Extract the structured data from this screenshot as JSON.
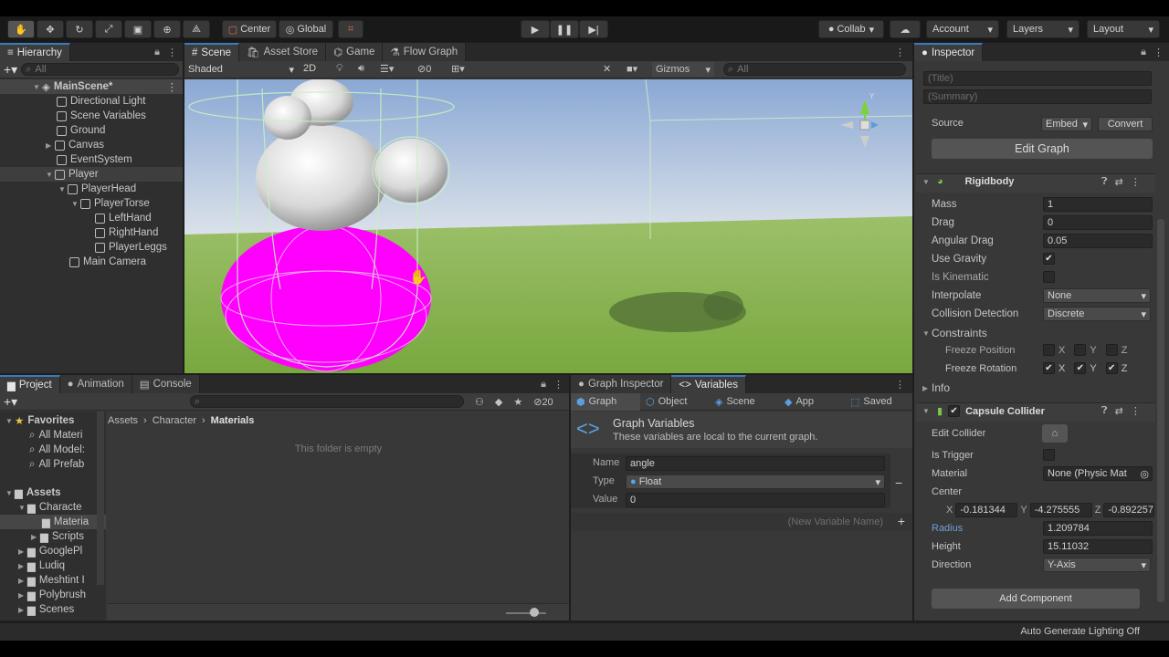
{
  "toolbar": {
    "pivot_center": "Center",
    "pivot_global": "Global",
    "collab": "Collab",
    "account": "Account",
    "layers": "Layers",
    "layout": "Layout"
  },
  "hierarchy": {
    "tab": "Hierarchy",
    "search_placeholder": "All",
    "scene": "MainScene*",
    "items": [
      {
        "label": "Directional Light"
      },
      {
        "label": "Scene Variables"
      },
      {
        "label": "Ground"
      },
      {
        "label": "Canvas"
      },
      {
        "label": "EventSystem"
      },
      {
        "label": "Player"
      },
      {
        "label": "PlayerHead"
      },
      {
        "label": "PlayerTorse"
      },
      {
        "label": "LeftHand"
      },
      {
        "label": "RightHand"
      },
      {
        "label": "PlayerLeggs"
      },
      {
        "label": "Main Camera"
      }
    ]
  },
  "scene_tabs": [
    "Scene",
    "Asset Store",
    "Game",
    "Flow Graph"
  ],
  "scene_toolbar": {
    "shading": "Shaded",
    "mode_2d": "2D",
    "gizmos": "Gizmos",
    "search_placeholder": "All",
    "fx_count": "0"
  },
  "project": {
    "tabs": [
      "Project",
      "Animation",
      "Console"
    ],
    "hidden_count": "20",
    "favorites": "Favorites",
    "fav_items": [
      "All Materi",
      "All Model:",
      "All Prefab"
    ],
    "assets": "Assets",
    "asset_items": [
      "Characte",
      "Materia",
      "Scripts",
      "GooglePl",
      "Ludiq",
      "Meshtint I",
      "Polybrush",
      "Scenes"
    ],
    "breadcrumb": [
      "Assets",
      "Character",
      "Materials"
    ],
    "empty": "This folder is empty"
  },
  "graph_inspector": {
    "tabs": [
      "Graph Inspector",
      "Variables"
    ],
    "scopes": [
      "Graph",
      "Object",
      "Scene",
      "App",
      "Saved"
    ],
    "title": "Graph Variables",
    "subtitle": "These variables are local to the current graph.",
    "name_label": "Name",
    "name_value": "angle",
    "type_label": "Type",
    "type_value": "Float",
    "value_label": "Value",
    "value_value": "0",
    "new_var_placeholder": "(New Variable Name)"
  },
  "inspector": {
    "tab": "Inspector",
    "title_placeholder": "(Title)",
    "summary_placeholder": "(Summary)",
    "source_label": "Source",
    "source_value": "Embed",
    "convert": "Convert",
    "edit_graph": "Edit Graph",
    "rigidbody": {
      "header": "Rigidbody",
      "mass_label": "Mass",
      "mass": "1",
      "drag_label": "Drag",
      "drag": "0",
      "angular_drag_label": "Angular Drag",
      "angular_drag": "0.05",
      "use_gravity_label": "Use Gravity",
      "is_kinematic_label": "Is Kinematic",
      "interpolate_label": "Interpolate",
      "interpolate": "None",
      "collision_label": "Collision Detection",
      "collision": "Discrete",
      "constraints": "Constraints",
      "freeze_pos": "Freeze Position",
      "freeze_rot": "Freeze Rotation",
      "info": "Info"
    },
    "capsule": {
      "header": "Capsule Collider",
      "edit_collider": "Edit Collider",
      "is_trigger": "Is Trigger",
      "material_label": "Material",
      "material": "None (Physic Mat",
      "center_label": "Center",
      "cx": "-0.181344",
      "cy": "-4.275555",
      "cz": "-0.892257",
      "radius_label": "Radius",
      "radius": "1.209784",
      "height_label": "Height",
      "height": "15.11032",
      "direction_label": "Direction",
      "direction": "Y-Axis"
    },
    "add_component": "Add Component"
  },
  "status": "Auto Generate Lighting Off",
  "axis_labels": {
    "x": "X",
    "y": "Y",
    "z": "Z"
  },
  "colors": {
    "accent": "#3a79bb",
    "magenta": "#ff00ff",
    "ground": "#86b84e",
    "sky": "#b3c9e6"
  }
}
